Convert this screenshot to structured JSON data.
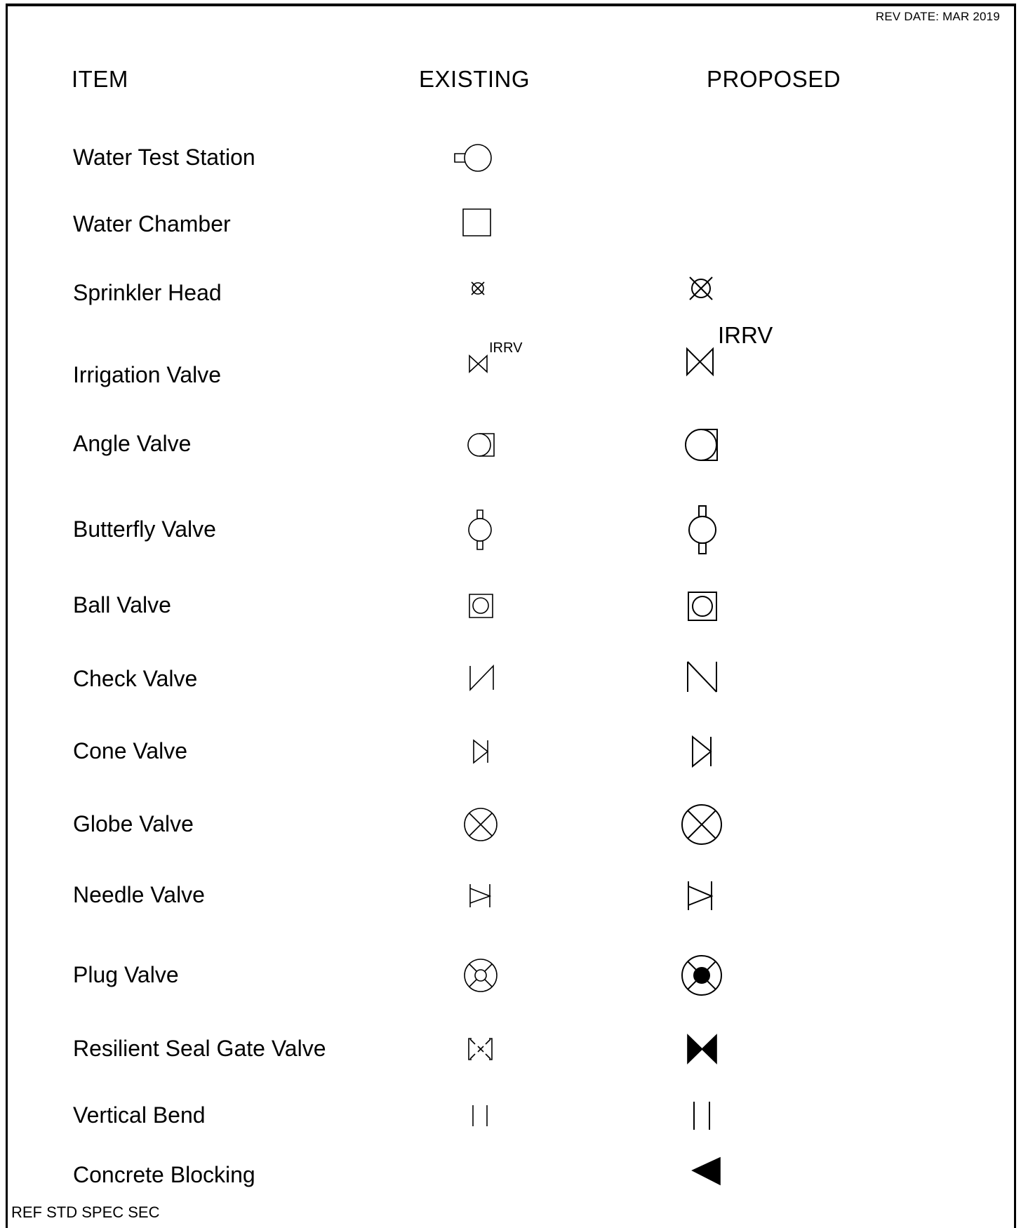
{
  "rev_date": "REV DATE: MAR 2019",
  "headers": {
    "item": "ITEM",
    "existing": "EXISTING",
    "proposed": "PROPOSED"
  },
  "rows": [
    {
      "label": "Water Test Station",
      "existing_icon": "water-test-station-icon",
      "proposed_icon": ""
    },
    {
      "label": "Water Chamber",
      "existing_icon": "water-chamber-icon",
      "proposed_icon": ""
    },
    {
      "label": "Sprinkler Head",
      "existing_icon": "sprinkler-head-icon",
      "proposed_icon": "sprinkler-head-icon"
    },
    {
      "label": "Irrigation Valve",
      "existing_icon": "irrigation-valve-icon",
      "proposed_icon": "irrigation-valve-icon",
      "symbol_text": "IRRV"
    },
    {
      "label": "Angle Valve",
      "existing_icon": "angle-valve-icon",
      "proposed_icon": "angle-valve-icon"
    },
    {
      "label": "Butterfly Valve",
      "existing_icon": "butterfly-valve-icon",
      "proposed_icon": "butterfly-valve-icon"
    },
    {
      "label": "Ball Valve",
      "existing_icon": "ball-valve-icon",
      "proposed_icon": "ball-valve-icon"
    },
    {
      "label": "Check Valve",
      "existing_icon": "check-valve-icon",
      "proposed_icon": "check-valve-icon"
    },
    {
      "label": "Cone Valve",
      "existing_icon": "cone-valve-icon",
      "proposed_icon": "cone-valve-icon"
    },
    {
      "label": "Globe Valve",
      "existing_icon": "globe-valve-icon",
      "proposed_icon": "globe-valve-icon"
    },
    {
      "label": "Needle Valve",
      "existing_icon": "needle-valve-icon",
      "proposed_icon": "needle-valve-icon"
    },
    {
      "label": "Plug Valve",
      "existing_icon": "plug-valve-icon",
      "proposed_icon": "plug-valve-filled-icon"
    },
    {
      "label": "Resilient Seal Gate Valve",
      "existing_icon": "resilient-seal-gate-valve-icon",
      "proposed_icon": "resilient-seal-gate-valve-filled-icon"
    },
    {
      "label": "Vertical Bend",
      "existing_icon": "vertical-bend-icon",
      "proposed_icon": "vertical-bend-icon"
    },
    {
      "label": "Concrete Blocking",
      "existing_icon": "",
      "proposed_icon": "concrete-blocking-icon"
    }
  ],
  "footer": "REF STD SPEC SEC"
}
